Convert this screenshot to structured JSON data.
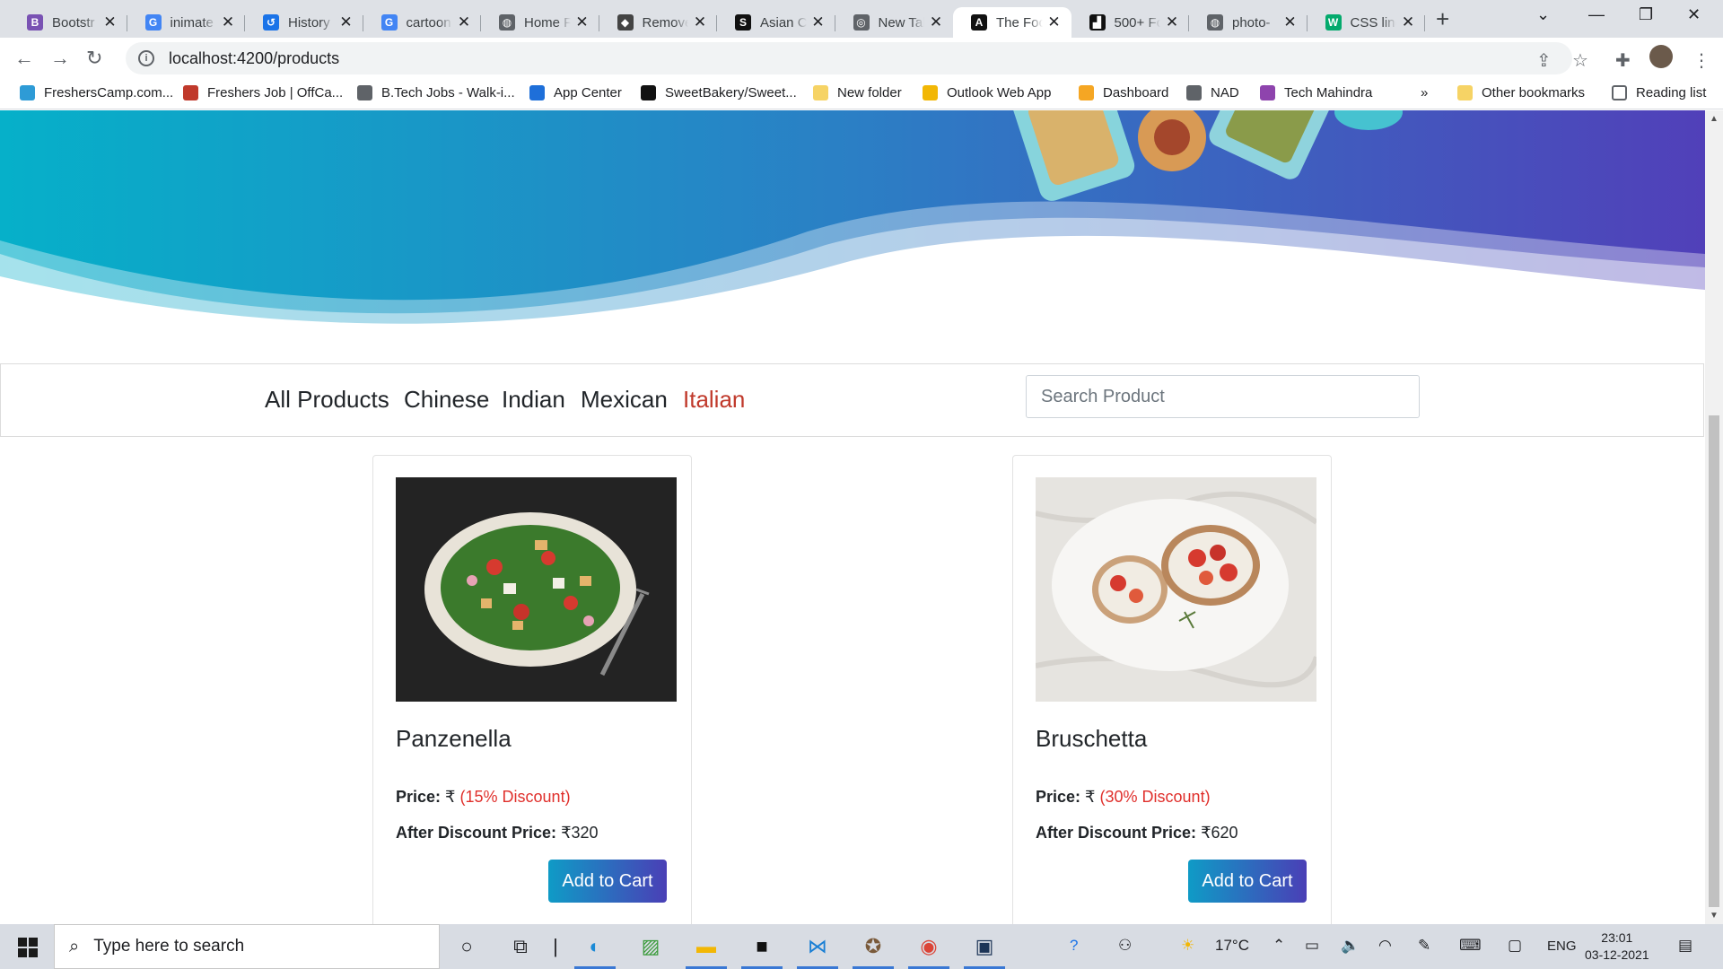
{
  "browser": {
    "tabs": [
      {
        "title": "Bootstr",
        "icon": "bootstrap-icon",
        "color": "#7952b3",
        "glyph": "B"
      },
      {
        "title": "inimate",
        "icon": "google-icon",
        "color": "#4285f4",
        "glyph": "G"
      },
      {
        "title": "History",
        "icon": "history-icon",
        "color": "#1a73e8",
        "glyph": "↺"
      },
      {
        "title": "cartoon",
        "icon": "google-icon",
        "color": "#4285f4",
        "glyph": "G"
      },
      {
        "title": "Home F",
        "icon": "globe-icon",
        "color": "#5f6368",
        "glyph": "◍"
      },
      {
        "title": "Remove",
        "icon": "remove-bg-icon",
        "color": "#444",
        "glyph": "◆"
      },
      {
        "title": "Asian C",
        "icon": "is-icon",
        "color": "#111",
        "glyph": "S"
      },
      {
        "title": "New Tal",
        "icon": "chrome-icon",
        "color": "#5f6368",
        "glyph": "◎"
      },
      {
        "title": "The Foc",
        "icon": "angular-icon",
        "color": "#111",
        "glyph": "A"
      },
      {
        "title": "500+ Fc",
        "icon": "unsplash-icon",
        "color": "#111",
        "glyph": "▟"
      },
      {
        "title": "photo-",
        "icon": "globe-icon",
        "color": "#5f6368",
        "glyph": "◍"
      },
      {
        "title": "CSS line",
        "icon": "w3schools-icon",
        "color": "#04aa6d",
        "glyph": "W"
      }
    ],
    "active_tab_index": 8,
    "url": "localhost:4200/products",
    "bookmarks": [
      {
        "label": "FreshersCamp.com...",
        "color": "#2e9bd6"
      },
      {
        "label": "Freshers Job | OffCa...",
        "color": "#c0392b"
      },
      {
        "label": "B.Tech Jobs - Walk-i...",
        "color": "#5f6368"
      },
      {
        "label": "App Center",
        "color": "#1e6fd9"
      },
      {
        "label": "SweetBakery/Sweet...",
        "color": "#111"
      },
      {
        "label": "New folder",
        "color": "#f6d365"
      },
      {
        "label": "Outlook Web App",
        "color": "#f2b705"
      },
      {
        "label": "Dashboard",
        "color": "#f5a623"
      },
      {
        "label": "NAD",
        "color": "#5f6368"
      },
      {
        "label": "Tech Mahindra",
        "color": "#8e44ad"
      }
    ],
    "more_bookmarks": "»",
    "other_bookmarks": "Other bookmarks",
    "reading_list": "Reading list"
  },
  "products_page": {
    "categories": [
      "All Products",
      "Chinese",
      "Indian",
      "Mexican",
      "Italian"
    ],
    "active_category": "Italian",
    "search_placeholder": "Search Product",
    "products": [
      {
        "name": "Panzenella",
        "price_label": "Price:",
        "currency": "₹",
        "discount": "(15% Discount)",
        "after_label": "After Discount Price:",
        "after_price": "₹320",
        "button": "Add to Cart"
      },
      {
        "name": "Bruschetta",
        "price_label": "Price:",
        "currency": "₹",
        "discount": "(30% Discount)",
        "after_label": "After Discount Price:",
        "after_price": "₹620",
        "button": "Add to Cart"
      }
    ],
    "accent_gradient": [
      "#0f9bc6",
      "#4a3fb6"
    ],
    "active_color": "#c0392b",
    "discount_color": "#e0302c"
  },
  "taskbar": {
    "search_placeholder": "Type here to search",
    "weather": "17°C",
    "language": "ENG",
    "time": "23:01",
    "date": "03-12-2021"
  }
}
